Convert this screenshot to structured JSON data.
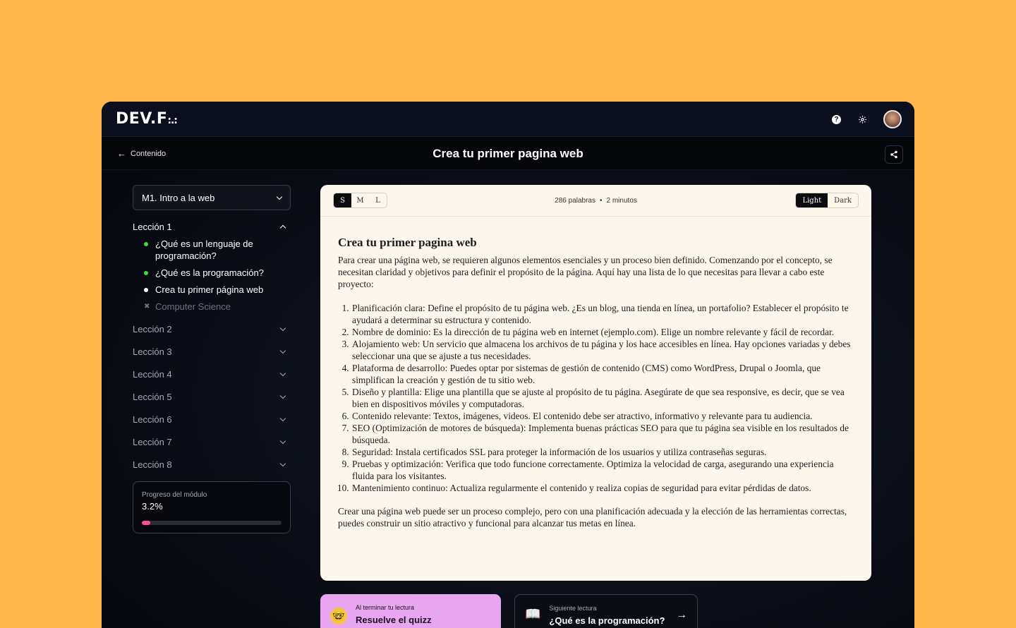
{
  "app": {
    "logo": "DEV.F",
    "logo_dots": ":.:"
  },
  "subbar": {
    "back_label": "Contenido",
    "title": "Crea tu primer pagina web"
  },
  "sidebar": {
    "module_select": "M1. Intro a la web",
    "lessons": [
      {
        "label": "Lección 1",
        "expanded": true,
        "items": [
          {
            "label": "¿Qué es un lenguaje de programación?",
            "status": "completed"
          },
          {
            "label": "¿Qué es la programación?",
            "status": "completed"
          },
          {
            "label": "Crea tu primer página web",
            "status": "current"
          },
          {
            "label": "Computer Science",
            "status": "locked"
          }
        ]
      },
      {
        "label": "Lección 2",
        "expanded": false
      },
      {
        "label": "Lección 3",
        "expanded": false
      },
      {
        "label": "Lección 4",
        "expanded": false
      },
      {
        "label": "Lección 5",
        "expanded": false
      },
      {
        "label": "Lección 6",
        "expanded": false
      },
      {
        "label": "Lección 7",
        "expanded": false
      },
      {
        "label": "Lección 8",
        "expanded": false
      }
    ],
    "progress": {
      "label": "Progreso del módulo",
      "value_text": "3.2%",
      "fraction": 0.032
    }
  },
  "reader": {
    "sizes": [
      "S",
      "M",
      "L"
    ],
    "selected_size": "S",
    "word_count": "286 palabras",
    "read_time": "2 minutos",
    "themes": [
      "Light",
      "Dark"
    ],
    "selected_theme": "Light",
    "article": {
      "title": "Crea tu primer pagina web",
      "intro": "Para crear una página web, se requieren algunos elementos esenciales y un proceso bien definido. Comenzando por el concepto, se necesitan claridad y objetivos para definir el propósito de la página. Aquí hay una lista de lo que necesitas para llevar a cabo este proyecto:",
      "steps": [
        "Planificación clara: Define el propósito de tu página web. ¿Es un blog, una tienda en línea, un portafolio? Establecer el propósito te ayudará a determinar su estructura y contenido.",
        "Nombre de dominio: Es la dirección de tu página web en internet (ejemplo.com). Elige un nombre relevante y fácil de recordar.",
        "Alojamiento web: Un servicio que almacena los archivos de tu página y los hace accesibles en línea. Hay opciones variadas y debes seleccionar una que se ajuste a tus necesidades.",
        "Plataforma de desarrollo: Puedes optar por sistemas de gestión de contenido (CMS) como WordPress, Drupal o Joomla, que simplifican la creación y gestión de tu sitio web.",
        "Diseño y plantilla: Elige una plantilla que se ajuste al propósito de tu página. Asegúrate de que sea responsive, es decir, que se vea bien en dispositivos móviles y computadoras.",
        "Contenido relevante: Textos, imágenes, videos. El contenido debe ser atractivo, informativo y relevante para tu audiencia.",
        "SEO (Optimización de motores de búsqueda): Implementa buenas prácticas SEO para que tu página sea visible en los resultados de búsqueda.",
        "Seguridad: Instala certificados SSL para proteger la información de los usuarios y utiliza contraseñas seguras.",
        "Pruebas y optimización: Verifica que todo funcione correctamente. Optimiza la velocidad de carga, asegurando una experiencia fluida para los visitantes.",
        "Mantenimiento continuo: Actualiza regularmente el contenido y realiza copias de seguridad para evitar pérdidas de datos."
      ],
      "conclusion": "Crear una página web puede ser un proceso complejo, pero con una planificación adecuada y la elección de las herramientas correctas, puedes construir un sitio atractivo y funcional para alcanzar tus metas en línea."
    }
  },
  "cta": {
    "quiz": {
      "small": "Al terminar tu lectura",
      "big": "Resuelve el quizz",
      "icon": "nerd-face-icon"
    },
    "next": {
      "small": "Siguiente lectura",
      "big": "¿Qué es la programación?",
      "icon": "book-icon"
    }
  },
  "colors": {
    "background": "#FFB74D",
    "progress_fill": "#ff4f9b",
    "completed_dot": "#3ddc3a",
    "reader_bg": "#fdf6ec",
    "quiz_bg": "#e9a6f0"
  }
}
